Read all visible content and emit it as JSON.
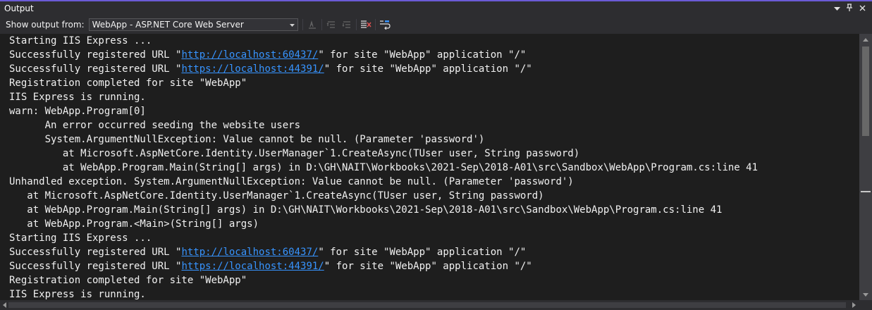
{
  "window": {
    "title": "Output",
    "icons": [
      "chevron-down-icon",
      "pin-icon",
      "close-icon"
    ]
  },
  "toolbar": {
    "show_label": "Show output from:",
    "source_selected": "WebApp - ASP.NET Core Web Server",
    "buttons": [
      "find-message-icon",
      "previous-message-icon",
      "next-message-icon",
      "clear-all-icon",
      "word-wrap-icon"
    ]
  },
  "colors": {
    "accent": "#6b5bd6",
    "background": "#1e1e1e",
    "chrome": "#2d2d30",
    "link": "#3794ff",
    "text": "#f1f1f1"
  },
  "output": {
    "lines": [
      {
        "text": "Starting IIS Express ..."
      },
      {
        "pre": "Successfully registered URL \"",
        "link": "http://localhost:60437/",
        "post": "\" for site \"WebApp\" application \"/\""
      },
      {
        "pre": "Successfully registered URL \"",
        "link": "https://localhost:44391/",
        "post": "\" for site \"WebApp\" application \"/\""
      },
      {
        "text": "Registration completed for site \"WebApp\""
      },
      {
        "text": "IIS Express is running."
      },
      {
        "text": "warn: WebApp.Program[0]"
      },
      {
        "text": "      An error occurred seeding the website users"
      },
      {
        "text": "      System.ArgumentNullException: Value cannot be null. (Parameter 'password')"
      },
      {
        "text": "         at Microsoft.AspNetCore.Identity.UserManager`1.CreateAsync(TUser user, String password)"
      },
      {
        "text": "         at WebApp.Program.Main(String[] args) in D:\\GH\\NAIT\\Workbooks\\2021-Sep\\2018-A01\\src\\Sandbox\\WebApp\\Program.cs:line 41"
      },
      {
        "text": "Unhandled exception. System.ArgumentNullException: Value cannot be null. (Parameter 'password')"
      },
      {
        "text": "   at Microsoft.AspNetCore.Identity.UserManager`1.CreateAsync(TUser user, String password)"
      },
      {
        "text": "   at WebApp.Program.Main(String[] args) in D:\\GH\\NAIT\\Workbooks\\2021-Sep\\2018-A01\\src\\Sandbox\\WebApp\\Program.cs:line 41"
      },
      {
        "text": "   at WebApp.Program.<Main>(String[] args)"
      },
      {
        "text": "Starting IIS Express ..."
      },
      {
        "pre": "Successfully registered URL \"",
        "link": "http://localhost:60437/",
        "post": "\" for site \"WebApp\" application \"/\""
      },
      {
        "pre": "Successfully registered URL \"",
        "link": "https://localhost:44391/",
        "post": "\" for site \"WebApp\" application \"/\""
      },
      {
        "text": "Registration completed for site \"WebApp\""
      },
      {
        "text": "IIS Express is running."
      }
    ]
  }
}
